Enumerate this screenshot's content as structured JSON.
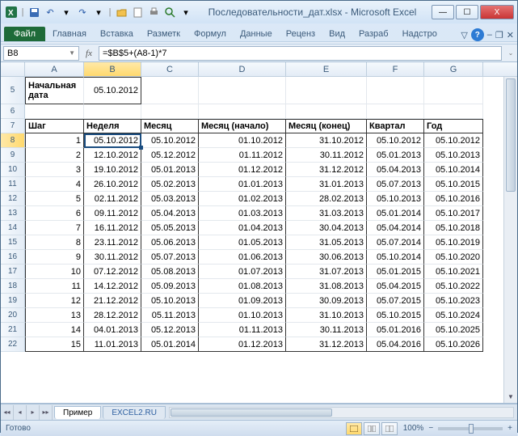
{
  "window": {
    "title": "Последовательности_дат.xlsx - Microsoft Excel",
    "min": "—",
    "max": "☐",
    "close": "X"
  },
  "ribbon": {
    "file": "Файл",
    "tabs": [
      "Главная",
      "Вставка",
      "Разметк",
      "Формул",
      "Данные",
      "Реценз",
      "Вид",
      "Разраб",
      "Надстро"
    ],
    "minimize": "▽"
  },
  "namebox": "B8",
  "formula": "=$B$5+(A8-1)*7",
  "columns": [
    "A",
    "B",
    "C",
    "D",
    "E",
    "F",
    "G"
  ],
  "row5": {
    "label": "Начальная дата",
    "value": "05.10.2012"
  },
  "row6_nums": [
    "5",
    "6",
    "7",
    "8",
    "9",
    "10",
    "11",
    "12",
    "13",
    "14",
    "15",
    "16",
    "17",
    "18",
    "19",
    "20",
    "21",
    "22"
  ],
  "headers": [
    "Шаг",
    "Неделя",
    "Месяц",
    "Месяц (начало)",
    "Месяц (конец)",
    "Квартал",
    "Год"
  ],
  "rows": [
    {
      "s": "1",
      "n": "05.10.2012",
      "m": "05.10.2012",
      "mb": "01.10.2012",
      "me": "31.10.2012",
      "q": "05.10.2012",
      "y": "05.10.2012"
    },
    {
      "s": "2",
      "n": "12.10.2012",
      "m": "05.12.2012",
      "mb": "01.11.2012",
      "me": "30.11.2012",
      "q": "05.01.2013",
      "y": "05.10.2013"
    },
    {
      "s": "3",
      "n": "19.10.2012",
      "m": "05.01.2013",
      "mb": "01.12.2012",
      "me": "31.12.2012",
      "q": "05.04.2013",
      "y": "05.10.2014"
    },
    {
      "s": "4",
      "n": "26.10.2012",
      "m": "05.02.2013",
      "mb": "01.01.2013",
      "me": "31.01.2013",
      "q": "05.07.2013",
      "y": "05.10.2015"
    },
    {
      "s": "5",
      "n": "02.11.2012",
      "m": "05.03.2013",
      "mb": "01.02.2013",
      "me": "28.02.2013",
      "q": "05.10.2013",
      "y": "05.10.2016"
    },
    {
      "s": "6",
      "n": "09.11.2012",
      "m": "05.04.2013",
      "mb": "01.03.2013",
      "me": "31.03.2013",
      "q": "05.01.2014",
      "y": "05.10.2017"
    },
    {
      "s": "7",
      "n": "16.11.2012",
      "m": "05.05.2013",
      "mb": "01.04.2013",
      "me": "30.04.2013",
      "q": "05.04.2014",
      "y": "05.10.2018"
    },
    {
      "s": "8",
      "n": "23.11.2012",
      "m": "05.06.2013",
      "mb": "01.05.2013",
      "me": "31.05.2013",
      "q": "05.07.2014",
      "y": "05.10.2019"
    },
    {
      "s": "9",
      "n": "30.11.2012",
      "m": "05.07.2013",
      "mb": "01.06.2013",
      "me": "30.06.2013",
      "q": "05.10.2014",
      "y": "05.10.2020"
    },
    {
      "s": "10",
      "n": "07.12.2012",
      "m": "05.08.2013",
      "mb": "01.07.2013",
      "me": "31.07.2013",
      "q": "05.01.2015",
      "y": "05.10.2021"
    },
    {
      "s": "11",
      "n": "14.12.2012",
      "m": "05.09.2013",
      "mb": "01.08.2013",
      "me": "31.08.2013",
      "q": "05.04.2015",
      "y": "05.10.2022"
    },
    {
      "s": "12",
      "n": "21.12.2012",
      "m": "05.10.2013",
      "mb": "01.09.2013",
      "me": "30.09.2013",
      "q": "05.07.2015",
      "y": "05.10.2023"
    },
    {
      "s": "13",
      "n": "28.12.2012",
      "m": "05.11.2013",
      "mb": "01.10.2013",
      "me": "31.10.2013",
      "q": "05.10.2015",
      "y": "05.10.2024"
    },
    {
      "s": "14",
      "n": "04.01.2013",
      "m": "05.12.2013",
      "mb": "01.11.2013",
      "me": "30.11.2013",
      "q": "05.01.2016",
      "y": "05.10.2025"
    },
    {
      "s": "15",
      "n": "11.01.2013",
      "m": "05.01.2014",
      "mb": "01.12.2013",
      "me": "31.12.2013",
      "q": "05.04.2016",
      "y": "05.10.2026"
    }
  ],
  "sheets": {
    "active": "Пример",
    "other": "EXCEL2.RU"
  },
  "status": {
    "ready": "Готово",
    "zoom": "100%",
    "minus": "−",
    "plus": "+"
  },
  "icons": {
    "xl": "X",
    "dd": "▾",
    "help": "?",
    "nav": [
      "◂◂",
      "◂",
      "▸",
      "▸▸"
    ]
  }
}
